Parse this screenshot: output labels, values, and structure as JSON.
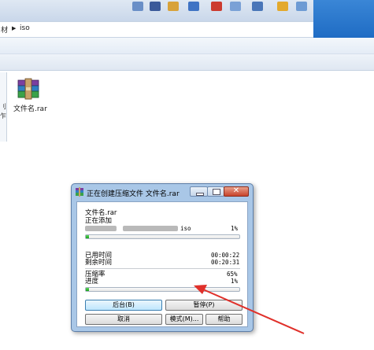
{
  "address_bar": {
    "prev_crumb": "材",
    "current_crumb": "iso"
  },
  "file": {
    "name": "文件名.rar"
  },
  "dialog": {
    "title": "正在创建压缩文件 文件名.rar",
    "archive_label": "文件名.rar",
    "adding_label": "正在添加",
    "current_file_ext": "iso",
    "file_progress_pct": "1%",
    "file_progress": 0.01,
    "elapsed_label": "已用时间",
    "elapsed_value": "00:00:22",
    "remaining_label": "剩余时间",
    "remaining_value": "00:20:31",
    "ratio_label": "压缩率",
    "ratio_value": "65%",
    "progress_label": "进度",
    "progress_value": "1%",
    "overall_progress": 0.01,
    "buttons": {
      "background": "后台(B)",
      "pause": "暂停(P)",
      "cancel": "取消",
      "mode": "模式(M)...",
      "help": "帮助"
    }
  },
  "colors": {
    "progress": "#22b022",
    "arrow": "#e0302a",
    "title_blue": "#a9c7e7"
  }
}
